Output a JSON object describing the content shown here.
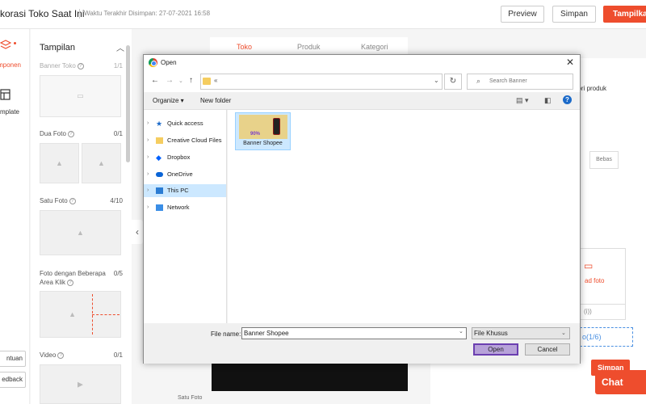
{
  "header": {
    "title": "korasi Toko Saat Ini",
    "saved_text": "Waktu Terakhir Disimpan: 27-07-2021 16:58",
    "preview_label": "Preview",
    "save_label": "Simpan",
    "show_label": "Tampilkan"
  },
  "rail": {
    "components_label": "mponen",
    "template_label": "mplate",
    "help_label": "ntuan",
    "feedback_label": "edback"
  },
  "panel": {
    "title": "Tampilan",
    "components": [
      {
        "label": "Banner Toko",
        "count": "1/1"
      },
      {
        "label": "Dua Foto",
        "count": "0/1"
      },
      {
        "label": "Satu Foto",
        "count": "4/10"
      },
      {
        "label": "Foto dengan Beberapa",
        "label2": "Area Klik",
        "count": "0/5"
      },
      {
        "label": "Video",
        "count": "0/1"
      }
    ]
  },
  "canvas": {
    "tabs": [
      "Toko",
      "Produk",
      "Kategori"
    ],
    "bottom_label": "Satu Foto"
  },
  "right_panel": {
    "kategori_text": "gori produk",
    "bebas_label": "Bebas",
    "upload_label": "ad foto",
    "select_text": "(i))",
    "count_text": "o(1/6)",
    "save_label": "Simpan",
    "chat_label": "Chat"
  },
  "dialog": {
    "title": "Open",
    "address_prefix": "«",
    "search_placeholder": "Search Banner",
    "organize_label": "Organize ▾",
    "new_folder_label": "New folder",
    "tree": [
      {
        "label": "Quick access",
        "icon": "star-icon",
        "selected": false
      },
      {
        "label": "Creative Cloud Files",
        "icon": "cc-folder-icon",
        "selected": false
      },
      {
        "label": "Dropbox",
        "icon": "dropbox-icon",
        "selected": false
      },
      {
        "label": "OneDrive",
        "icon": "cloud-icon",
        "selected": false
      },
      {
        "label": "This PC",
        "icon": "pc-icon",
        "selected": true
      },
      {
        "label": "Network",
        "icon": "network-icon",
        "selected": false
      }
    ],
    "file": {
      "name": "Banner Shopee",
      "thumb_text": "90%"
    },
    "filename_label": "File name:",
    "filename_value": "Banner Shopee",
    "filetype_value": "File Khusus",
    "open_label": "Open",
    "cancel_label": "Cancel"
  }
}
